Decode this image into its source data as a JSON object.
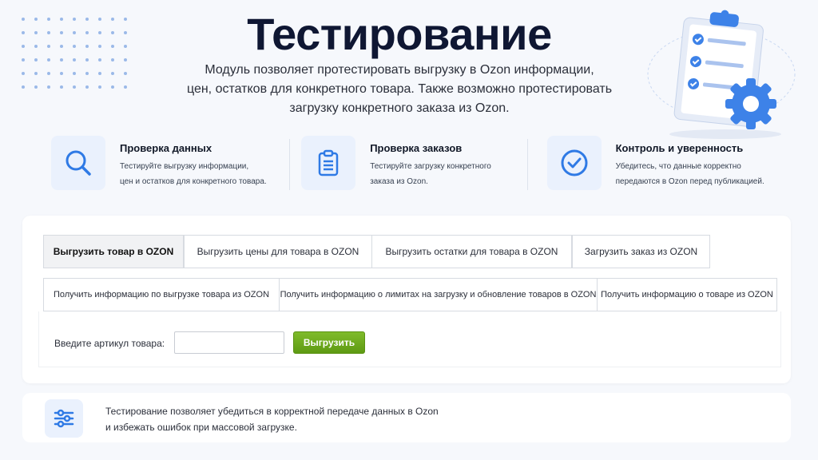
{
  "hero": {
    "title": "Тестирование",
    "description_line1": "Модуль позволяет протестировать выгрузку в Ozon информации,",
    "description_line2": "цен, остатков для конкретного товара. Также возможно протестировать",
    "description_line3": "загрузку конкретного заказа из Ozon."
  },
  "features": [
    {
      "title": "Проверка данных",
      "line1": "Тестируйте выгрузку информации,",
      "line2": "цен и остатков для конкретного товара.",
      "icon": "search-icon"
    },
    {
      "title": "Проверка заказов",
      "line1": "Тестируйте загрузку конкретного",
      "line2": "заказа из Ozon.",
      "icon": "clipboard-icon"
    },
    {
      "title": "Контроль и уверенность",
      "line1": "Убедитесь, что данные корректно",
      "line2": "передаются в Ozon перед публикацией.",
      "icon": "check-circle-icon"
    }
  ],
  "tabs_row1": [
    {
      "label": "Выгрузить товар в OZON",
      "active": true
    },
    {
      "label": "Выгрузить цены для товара в OZON",
      "active": false
    },
    {
      "label": "Выгрузить остатки для товара в OZON",
      "active": false
    },
    {
      "label": "Загрузить заказ из OZON",
      "active": false
    }
  ],
  "tabs_row2": [
    {
      "label": "Получить информацию по выгрузке товара из OZON"
    },
    {
      "label": "Получить информацию о лимитах на загрузку и обновление товаров в OZON"
    },
    {
      "label": "Получить информацию о товаре из OZON"
    }
  ],
  "form": {
    "article_label": "Введите артикул товара:",
    "article_value": "",
    "submit_label": "Выгрузить"
  },
  "note": {
    "line1": "Тестирование позволяет убедиться в корректной передаче данных в Ozon",
    "line2": "и избежать ошибок при массовой загрузке.",
    "icon": "sliders-icon"
  },
  "colors": {
    "accent": "#2f7ae5",
    "button_green": "#6aa81c",
    "title": "#0f1733"
  }
}
